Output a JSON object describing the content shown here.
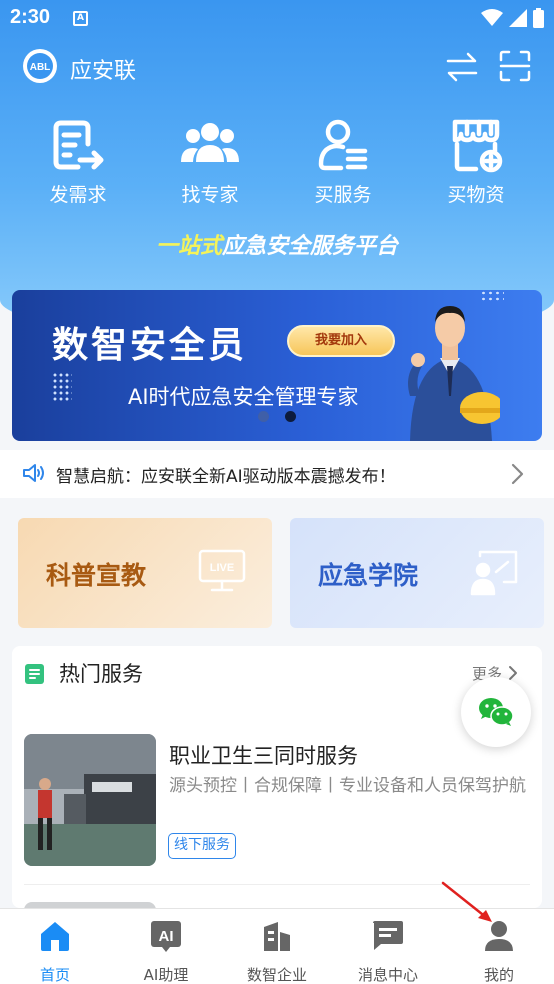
{
  "status_bar": {
    "time": "2:30",
    "notification_letter": "A"
  },
  "app": {
    "name": "应安联",
    "logo_text": "ABL"
  },
  "quick_actions": [
    {
      "label": "发需求",
      "icon": "document-send-icon"
    },
    {
      "label": "找专家",
      "icon": "people-icon"
    },
    {
      "label": "买服务",
      "icon": "person-list-icon"
    },
    {
      "label": "买物资",
      "icon": "store-icon"
    }
  ],
  "slogan": {
    "highlight": "一站式",
    "rest": "应急安全服务平台"
  },
  "banner": {
    "title": "数智安全员",
    "button": "我要加入",
    "subtitle": "AI时代应急安全管理专家",
    "page_count": 2,
    "active_page": 2
  },
  "notice": {
    "text": "智慧启航：应安联全新AI驱动版本震撼发布！"
  },
  "cards": [
    {
      "label": "科普宣教",
      "icon": "live-screen-icon",
      "color": "#a85a12"
    },
    {
      "label": "应急学院",
      "icon": "teacher-board-icon",
      "color": "#2e5fc8"
    }
  ],
  "hot_services": {
    "title": "热门服务",
    "more": "更多",
    "items": [
      {
        "title": "职业卫生三同时服务",
        "desc": "源头预控丨合规保障丨专业设备和人员保驾护航",
        "tag": "线下服务"
      }
    ]
  },
  "tabs": [
    {
      "label": "首页",
      "icon": "home-icon",
      "active": true
    },
    {
      "label": "AI助理",
      "icon": "ai-icon",
      "active": false
    },
    {
      "label": "数智企业",
      "icon": "building-icon",
      "active": false
    },
    {
      "label": "消息中心",
      "icon": "message-icon",
      "active": false
    },
    {
      "label": "我的",
      "icon": "user-icon",
      "active": false
    }
  ],
  "colors": {
    "primary": "#1a8cf5",
    "hero_top": "#3a96f0",
    "tag": "#2f86ea",
    "highlight": "#f4f35a"
  }
}
